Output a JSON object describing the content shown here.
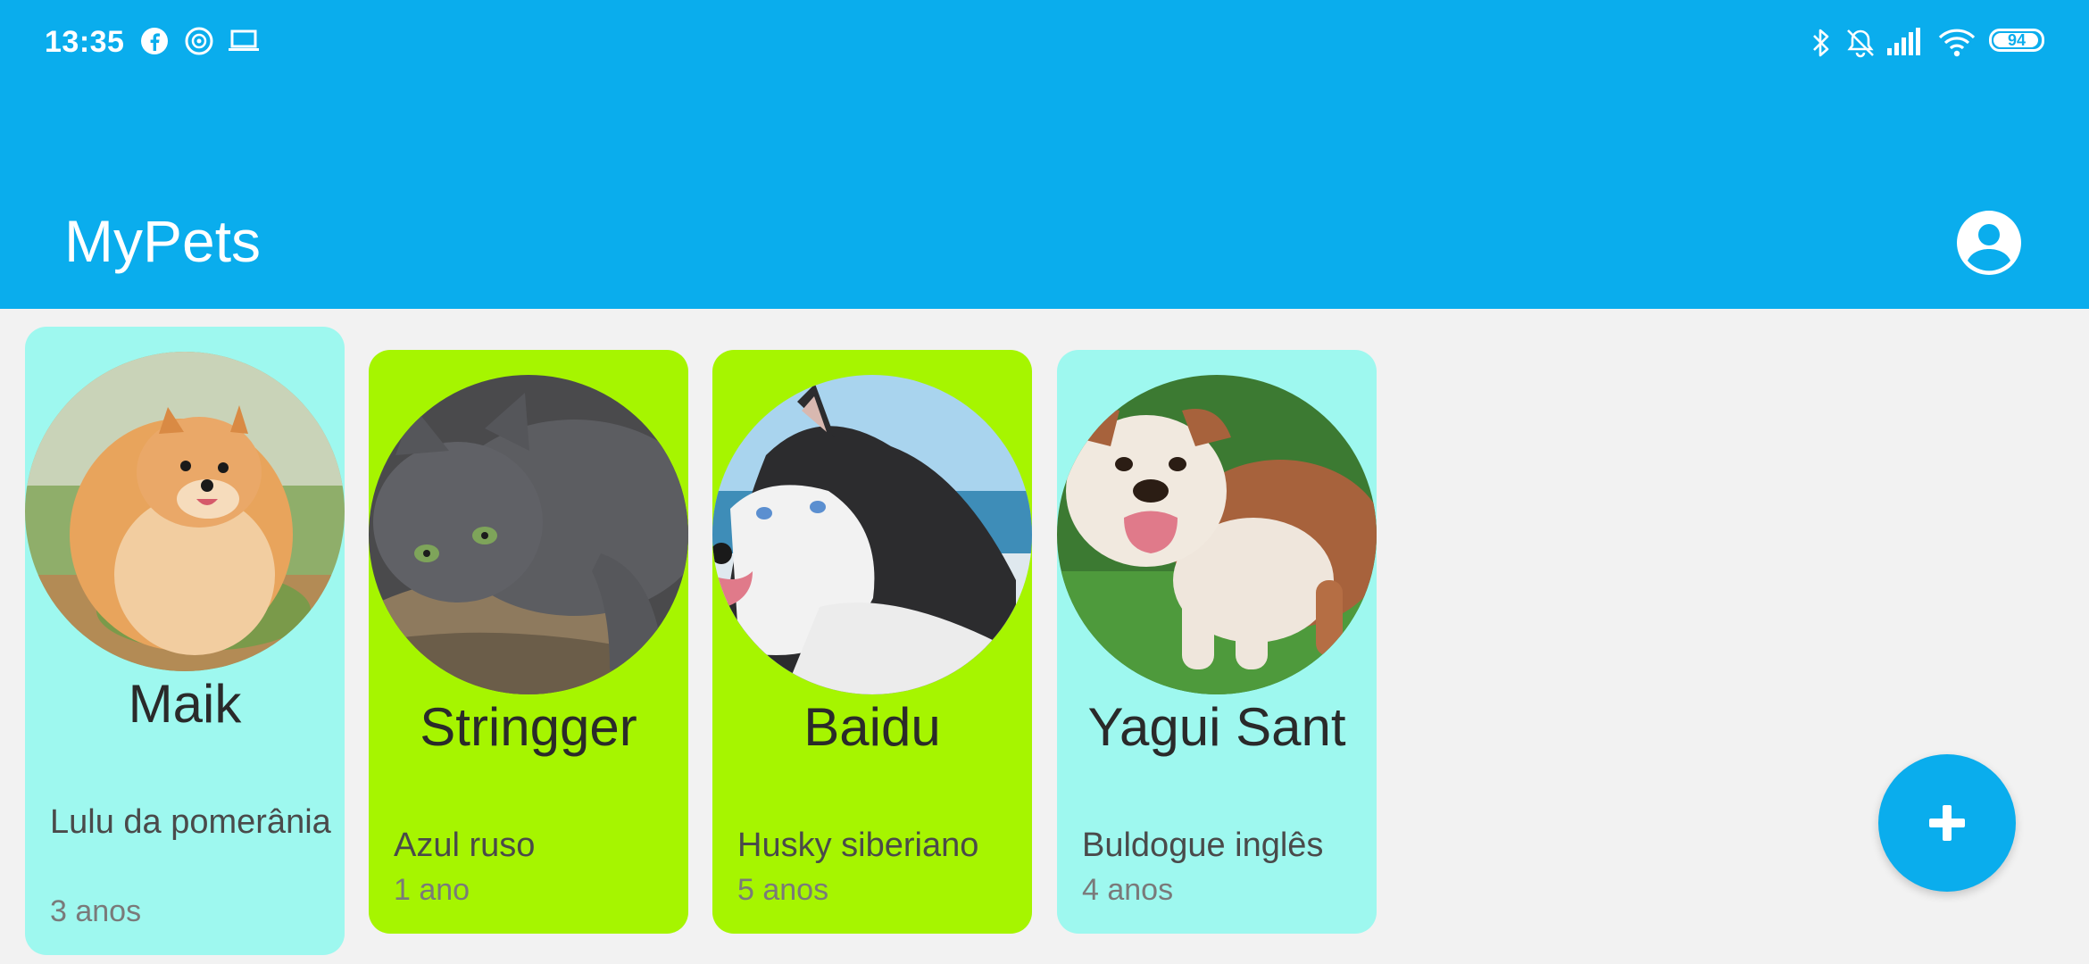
{
  "status_bar": {
    "time": "13:35",
    "left_icons": [
      "facebook-icon",
      "app-notification-icon",
      "laptop-icon"
    ],
    "right_icons": [
      "bluetooth-icon",
      "bell-off-icon",
      "signal-icon",
      "wifi-icon",
      "battery-icon"
    ],
    "battery": "94"
  },
  "app_bar": {
    "title": "MyPets",
    "action_icon": "account-circle-icon"
  },
  "colors": {
    "primary": "#0aaded",
    "card_cyan": "#9ef8ef",
    "card_lime": "#a6f500",
    "background": "#f2f2f2"
  },
  "pets": [
    {
      "name": "Maik",
      "breed": "Lulu da pomerânia",
      "age": "3 anos",
      "card_color": "#9ef8ef",
      "photo": "pomeranian-photo"
    },
    {
      "name": "Stringger",
      "breed": "Azul ruso",
      "age": "1 ano",
      "card_color": "#a6f500",
      "photo": "gray-cat-photo"
    },
    {
      "name": "Baidu",
      "breed": "Husky siberiano",
      "age": "5 anos",
      "card_color": "#a6f500",
      "photo": "husky-photo"
    },
    {
      "name": "Yagui Sant",
      "breed": "Buldogue inglês",
      "age": "4 anos",
      "card_color": "#9ef8ef",
      "photo": "bulldog-photo"
    }
  ],
  "fab": {
    "icon": "plus-icon"
  }
}
